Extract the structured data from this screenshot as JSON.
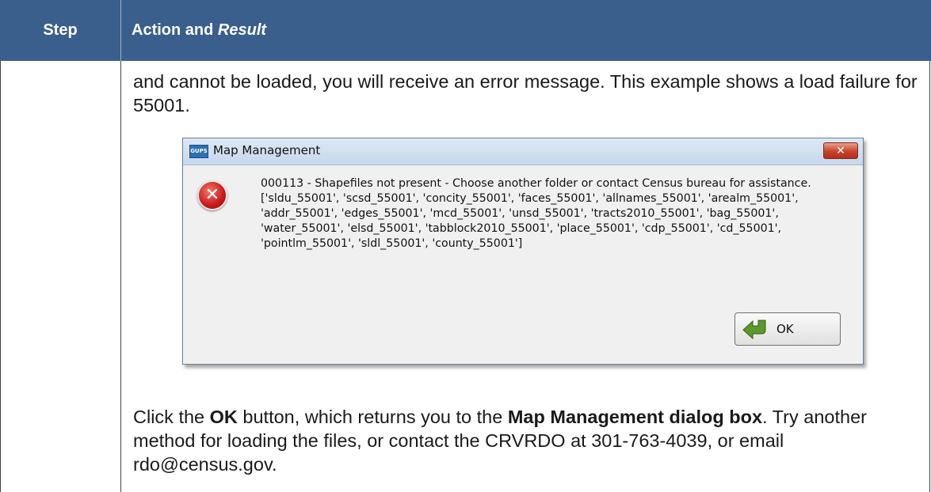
{
  "table": {
    "header_step": "Step",
    "header_action": "Action and",
    "header_result": "Result"
  },
  "content": {
    "paragraph1": "and cannot be loaded, you will receive an error message. This example shows a load failure for 55001.",
    "p2_part1": "Click the ",
    "p2_ok": "OK",
    "p2_part2": " button, which returns you to the ",
    "p2_dialog": "Map Management dialog box",
    "p2_part3": ". Try another method for loading the files, or contact the CRVRDO at 301-763-4039, or email rdo@census.gov."
  },
  "dialog": {
    "app_icon_text": "GUPS",
    "title": "Map Management",
    "close_label": "✕",
    "error_icon": "error-icon",
    "message": "000113 - Shapefiles not present - Choose another folder or contact Census bureau for assistance.\n['sldu_55001', 'scsd_55001', 'concity_55001', 'faces_55001', 'allnames_55001', 'arealm_55001', 'addr_55001', 'edges_55001', 'mcd_55001', 'unsd_55001', 'tracts2010_55001', 'bag_55001', 'water_55001', 'elsd_55001', 'tabblock2010_55001', 'place_55001', 'cdp_55001', 'cd_55001', 'pointlm_55001', 'sldl_55001', 'county_55001']",
    "ok_label": "OK"
  },
  "colors": {
    "header_bg": "#3a5f8d",
    "header_text": "#ffffff",
    "close_button": "#c8432a",
    "ok_arrow": "#5a9a2b"
  }
}
